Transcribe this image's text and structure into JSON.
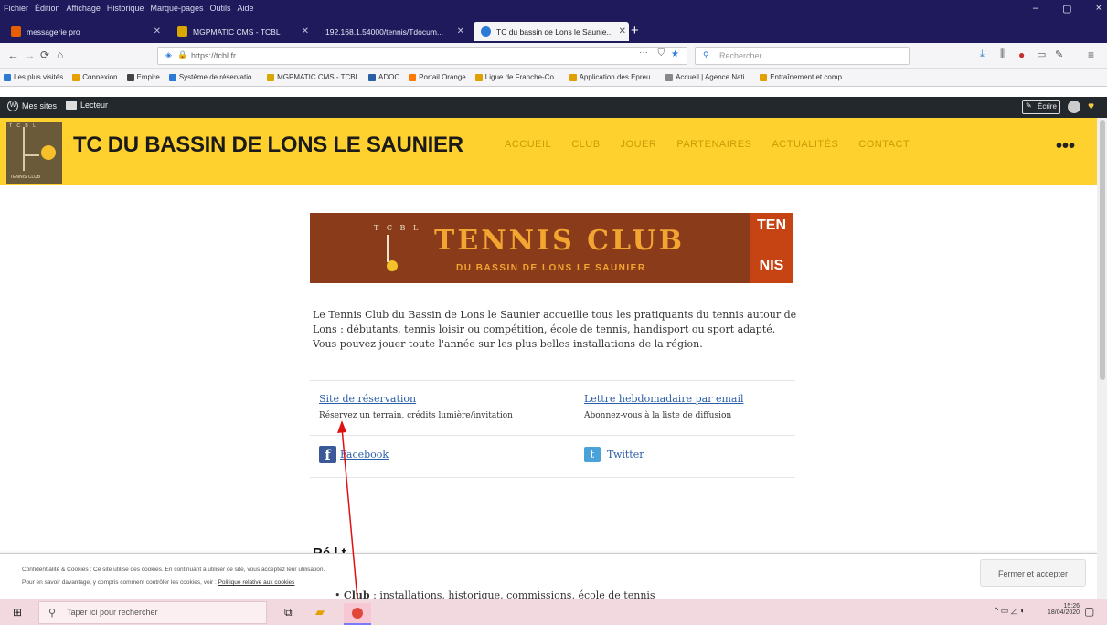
{
  "browser": {
    "menu": [
      "Fichier",
      "Édition",
      "Affichage",
      "Historique",
      "Marque-pages",
      "Outils",
      "Aide"
    ],
    "window_controls": [
      "–",
      "▢",
      "×"
    ],
    "tabs": [
      {
        "label": "messagerie pro",
        "color": "#e85d00"
      },
      {
        "label": "MGPMATIC CMS - TCBL",
        "color": "#d8a800"
      },
      {
        "label": "192.168.1.54000/tennis/Tdocum...",
        "color": "#7a7a7a"
      },
      {
        "label": "TC du bassin de Lons le Saunie...",
        "color": "#2a7ad6"
      }
    ],
    "active_tab_index": 3,
    "url": "https://tcbl.fr",
    "search_placeholder": "Rechercher",
    "bookmarks": [
      {
        "label": "Les plus visités",
        "color": "#2a7ad6"
      },
      {
        "label": "Connexion",
        "color": "#e6a000"
      },
      {
        "label": "Empire",
        "color": "#444"
      },
      {
        "label": "Système de réservatio...",
        "color": "#2a7ad6"
      },
      {
        "label": "MGPMATIC CMS - TCBL",
        "color": "#d8a800"
      },
      {
        "label": "ADOC",
        "color": "#2a5fa8"
      },
      {
        "label": "Portail Orange",
        "color": "#ff7900"
      },
      {
        "label": "Ligue de Franche-Co...",
        "color": "#e0a000"
      },
      {
        "label": "Application des Epreu...",
        "color": "#e0a000"
      },
      {
        "label": "Accueil | Agence Nati...",
        "color": "#888"
      },
      {
        "label": "Entraînement et comp...",
        "color": "#e0a000"
      }
    ]
  },
  "adminbar": {
    "my_sites": "Mes sites",
    "reader": "Lecteur",
    "write": "Écrire"
  },
  "site": {
    "title": "TC DU BASSIN DE LONS LE SAUNIER",
    "nav": [
      "ACCUEIL",
      "CLUB",
      "JOUER",
      "PARTENAIRES",
      "ACTUALITÉS",
      "CONTACT"
    ],
    "more": "•••",
    "logo_text": "TENNIS CLUB"
  },
  "banner": {
    "small": "T C B L",
    "title": "TENNIS CLUB",
    "subtitle": "DU BASSIN DE LONS LE SAUNIER",
    "badge_top": "TEN",
    "badge_bottom": "NIS"
  },
  "intro": "Le Tennis Club du Bassin de Lons le Saunier accueille tous les pratiquants du tennis autour de Lons : débutants, tennis loisir ou compétition, école de tennis, handisport ou sport adapté. Vous pouvez jouer toute l'année sur les plus belles installations de la région.",
  "links": [
    {
      "label": "Site de réservation",
      "desc": "Réservez un terrain, crédits lumière/invitation"
    },
    {
      "label": "Lettre hebdomadaire par email",
      "desc": "Abonnez-vous à la liste de diffusion"
    }
  ],
  "social": {
    "facebook": "Facebook",
    "twitter": "Twitter"
  },
  "partial_heading": "Ré   l    t  ",
  "club_line_label": "Club",
  "club_line_text": " : installations, historique, commissions, école de tennis",
  "cookie": {
    "line1": "Confidentialité & Cookies : Ce site utilise des cookies. En continuant à utiliser ce site, vous acceptez leur utilisation.",
    "line2": "Pour en savoir davantage, y compris comment contrôler les cookies, voir : ",
    "policy": "Politique relative aux cookies",
    "button": "Fermer et accepter"
  },
  "taskbar": {
    "search_placeholder": "Taper ici pour rechercher",
    "time": "15:26",
    "date": "18/04/2020"
  },
  "annotation_color": "#e01010"
}
